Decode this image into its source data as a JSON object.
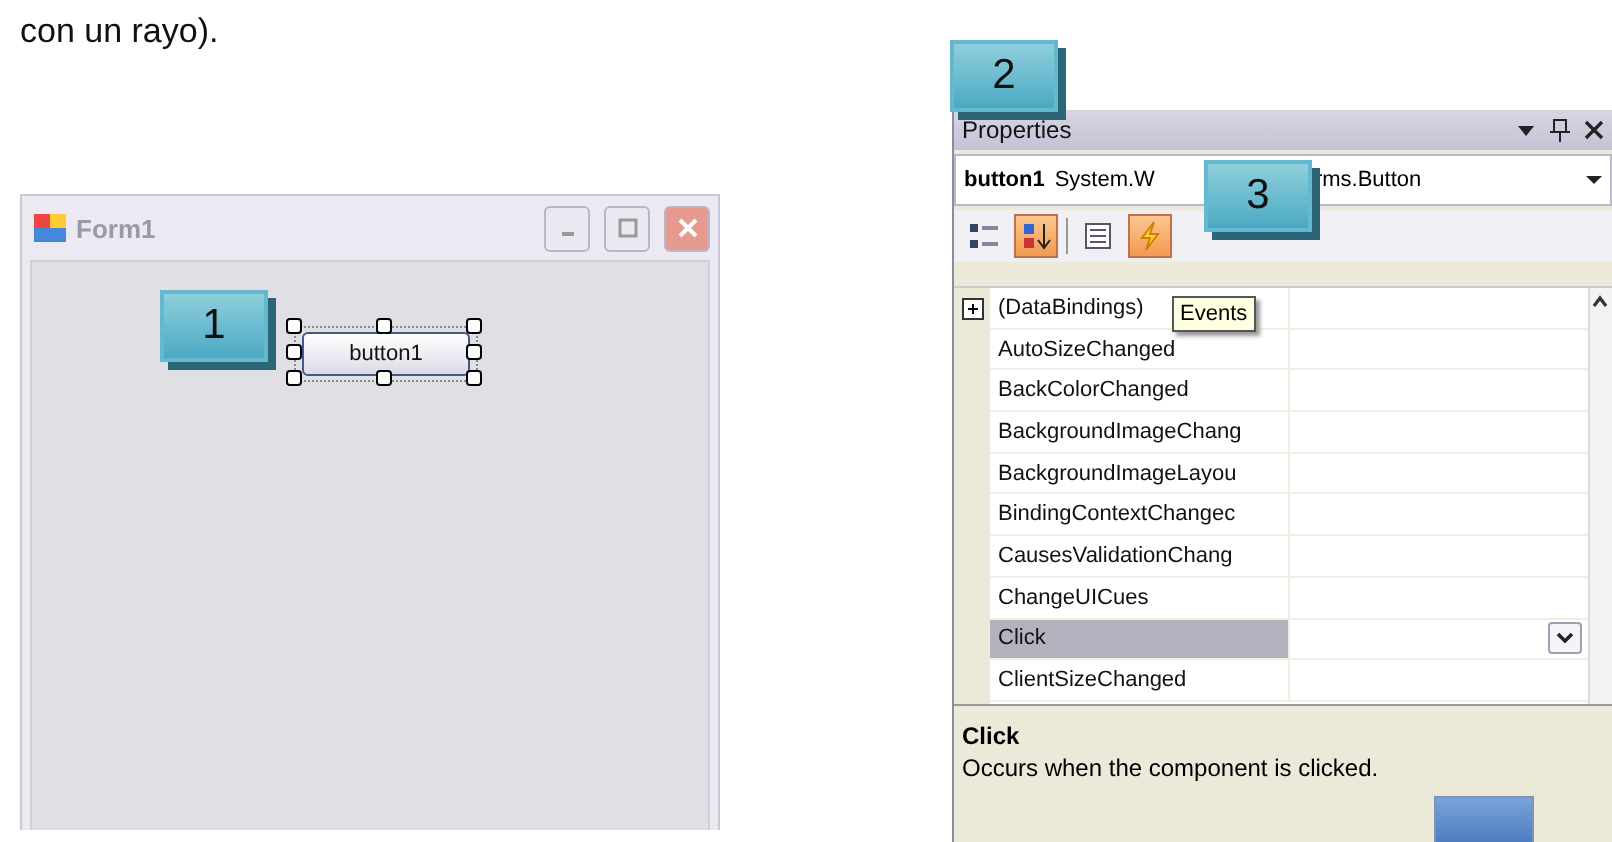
{
  "caption": "con un rayo).",
  "callouts": [
    "1",
    "2",
    "3"
  ],
  "form_window": {
    "title": "Form1",
    "button": "button1"
  },
  "properties": {
    "title": "Properties",
    "object_name": "button1",
    "object_type_parts": [
      "System.W",
      "rms.Button"
    ],
    "toolbar": [
      {
        "kind": "categorized",
        "selected": false
      },
      {
        "kind": "alphabetical",
        "selected": true
      },
      {
        "kind": "properties",
        "selected": false
      },
      {
        "kind": "events",
        "selected": true
      }
    ],
    "tooltip": "Events",
    "rows": [
      {
        "name": "(DataBindings)",
        "expandable": true,
        "selected": false
      },
      {
        "name": "AutoSizeChanged",
        "expandable": false,
        "selected": false
      },
      {
        "name": "BackColorChanged",
        "expandable": false,
        "selected": false
      },
      {
        "name": "BackgroundImageChang",
        "expandable": false,
        "selected": false
      },
      {
        "name": "BackgroundImageLayou",
        "expandable": false,
        "selected": false
      },
      {
        "name": "BindingContextChangec",
        "expandable": false,
        "selected": false
      },
      {
        "name": "CausesValidationChang",
        "expandable": false,
        "selected": false
      },
      {
        "name": "ChangeUICues",
        "expandable": false,
        "selected": false
      },
      {
        "name": "Click",
        "expandable": false,
        "selected": true
      },
      {
        "name": "ClientSizeChanged",
        "expandable": false,
        "selected": false
      }
    ],
    "description": {
      "title": "Click",
      "text": "Occurs when the component is clicked."
    }
  }
}
